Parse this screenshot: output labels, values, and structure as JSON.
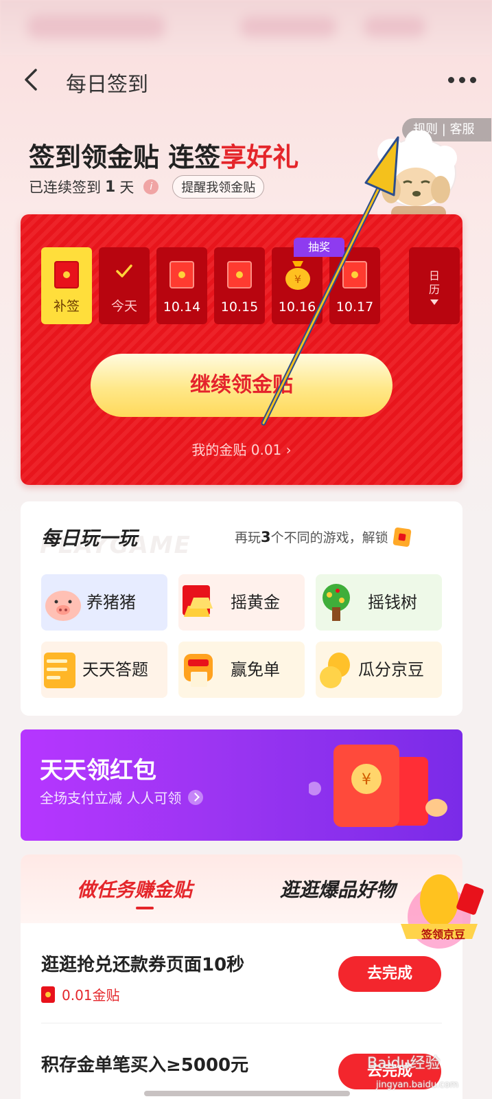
{
  "nav": {
    "title": "每日签到"
  },
  "rules_pill": "规则 | 客服",
  "header": {
    "headline_a": "签到领金贴 连签",
    "headline_b": "享好礼",
    "streak_prefix": "已连续签到",
    "streak_days": "1",
    "streak_suffix": "天",
    "info": "i",
    "remind_button": "提醒我领金贴"
  },
  "signin": {
    "days": [
      {
        "label": "补签",
        "state": "makeup"
      },
      {
        "label": "今天",
        "state": "checked"
      },
      {
        "label": "10.14",
        "state": "envelope"
      },
      {
        "label": "10.15",
        "state": "envelope"
      },
      {
        "label": "10.16",
        "state": "lottery"
      },
      {
        "label": "10.17",
        "state": "envelope"
      }
    ],
    "lottery_tag": "抽奖",
    "calendar_label": "日历",
    "continue_button": "继续领金贴",
    "my_gold": "我的金贴 0.01 ›"
  },
  "games": {
    "title": "每日玩一玩",
    "watermark": "PLAYGAME",
    "hint_prefix": "再玩",
    "hint_count": "3",
    "hint_suffix": "个不同的游戏，解锁",
    "items": [
      {
        "label": "养猪猪",
        "icon": "pig-icon"
      },
      {
        "label": "摇黄金",
        "icon": "gold-bar-icon"
      },
      {
        "label": "摇钱树",
        "icon": "money-tree-icon"
      },
      {
        "label": "天天答题",
        "icon": "quiz-icon"
      },
      {
        "label": "赢免单",
        "icon": "free-order-icon"
      },
      {
        "label": "瓜分京豆",
        "icon": "jd-bean-icon"
      }
    ]
  },
  "banner": {
    "title": "天天领红包",
    "subtitle": "全场支付立减 人人可领"
  },
  "tasks": {
    "tab_active": "做任务赚金贴",
    "tab_other": "逛逛爆品好物",
    "items": [
      {
        "title": "逛逛抢兑还款券页面10秒",
        "reward": "0.01金贴",
        "button": "去完成"
      },
      {
        "title": "积存金单笔买入≥5000元",
        "button": "去完成"
      }
    ]
  },
  "bean_badge": "签领京豆",
  "watermark": {
    "main": "Baidu经验",
    "sub": "jingyan.baidu.com"
  },
  "colors": {
    "accent_red": "#e4252a",
    "card_red": "#e8151c",
    "banner_purple": "#9b35f2",
    "gold": "#ffde3b"
  }
}
